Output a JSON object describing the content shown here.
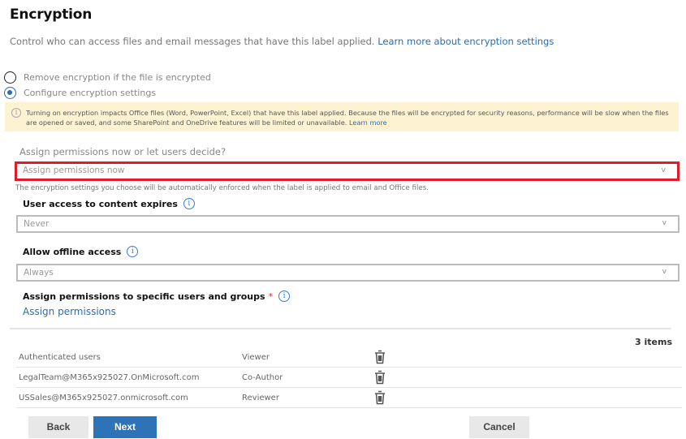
{
  "page": {
    "title": "Encryption",
    "subtitle": "Control who can access files and email messages that have this label applied. ",
    "subtitle_link": "Learn more about encryption settings"
  },
  "encryption_mode": {
    "options": [
      {
        "label": "Remove encryption if the file is encrypted",
        "selected": false
      },
      {
        "label": "Configure encryption settings",
        "selected": true
      }
    ]
  },
  "warning": {
    "icon": "info-icon",
    "text": "Turning on encryption impacts Office files (Word, PowerPoint, Excel) that have this label applied. Because the files will be encrypted for security reasons, performance will be slow when the files are opened or saved, and some SharePoint and OneDrive features will be limited or unavailable. ",
    "link": "Learn more",
    "background": "#fdf3d3"
  },
  "assign_mode": {
    "label": "Assign permissions now or let users decide?",
    "value": "Assign permissions now",
    "help": "The encryption settings you choose will be automatically enforced when the label is applied to email and Office files.",
    "highlight_color": "#e01b2a"
  },
  "expires": {
    "label": "User access to content expires",
    "value": "Never"
  },
  "offline": {
    "label": "Allow offline access",
    "value": "Always"
  },
  "permissions": {
    "label": "Assign permissions to specific users and groups",
    "required_mark": "*",
    "link": "Assign permissions",
    "count": "3 items",
    "rows": [
      {
        "user": "Authenticated users",
        "role": "Viewer"
      },
      {
        "user": "LegalTeam@M365x925027.OnMicrosoft.com",
        "role": "Co-Author"
      },
      {
        "user": "USSales@M365x925027.onmicrosoft.com",
        "role": "Reviewer"
      }
    ]
  },
  "footer": {
    "back": "Back",
    "next": "Next",
    "cancel": "Cancel"
  },
  "icons": {
    "chevron": "v",
    "info": "i"
  }
}
